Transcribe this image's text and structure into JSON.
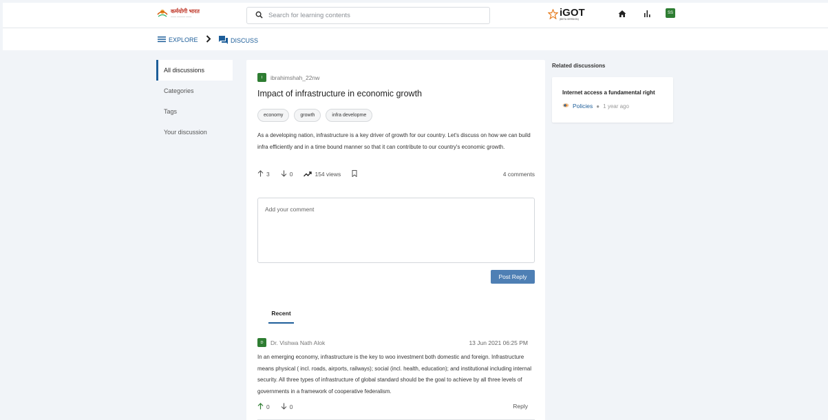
{
  "header": {
    "logo_text": "कर्मयोगी भारत",
    "logo_sub": "—— ——— ——",
    "search_placeholder": "Search for learning contents",
    "brand": "iGOT",
    "brand_sub": "(BETA VERSION)",
    "avatar_initials": "SS"
  },
  "breadcrumb": {
    "explore": "EXPLORE",
    "discuss": "DISCUSS"
  },
  "sidebar": {
    "items": [
      {
        "label": "All discussions"
      },
      {
        "label": "Categories"
      },
      {
        "label": "Tags"
      },
      {
        "label": "Your discussion"
      }
    ]
  },
  "post": {
    "author_initial": "I",
    "author": "ibrahimshah_22nw",
    "title": "Impact of infrastructure in economic growth",
    "tags": [
      "economy",
      "growth",
      "infra developme"
    ],
    "body": "As a developing nation, infrastructure is a key driver of growth for our country. Let's discuss on how we can build infra efficiently and in a time bound manner so that it can contribute to our country's economic growth.",
    "upvotes": "3",
    "downvotes": "0",
    "views": "154 views",
    "comments": "4 comments"
  },
  "comment_form": {
    "placeholder": "Add your comment",
    "post_label": "Post Reply"
  },
  "tabs": {
    "recent": "Recent"
  },
  "comment": {
    "author_initial": "D",
    "author": "Dr. Vishwa Nath Alok",
    "date": "13 Jun 2021 06:25 PM",
    "text": "In an emerging economy, infrastructure is the key to woo investment both domestic and foreign. Infrastructure means physical ( incl. roads, airports, railways); social (incl. health, education); and institutional including internal security. All three types of infrastructure of global standard should be the goal to achieve by all three levels of governments in a framework of cooperative federalism.",
    "upvotes": "0",
    "downvotes": "0",
    "reply_label": "Reply"
  },
  "related": {
    "heading": "Related discussions",
    "items": [
      {
        "title": "Internet access a fundamental right",
        "category": "Policies",
        "time": "1 year ago"
      }
    ]
  }
}
